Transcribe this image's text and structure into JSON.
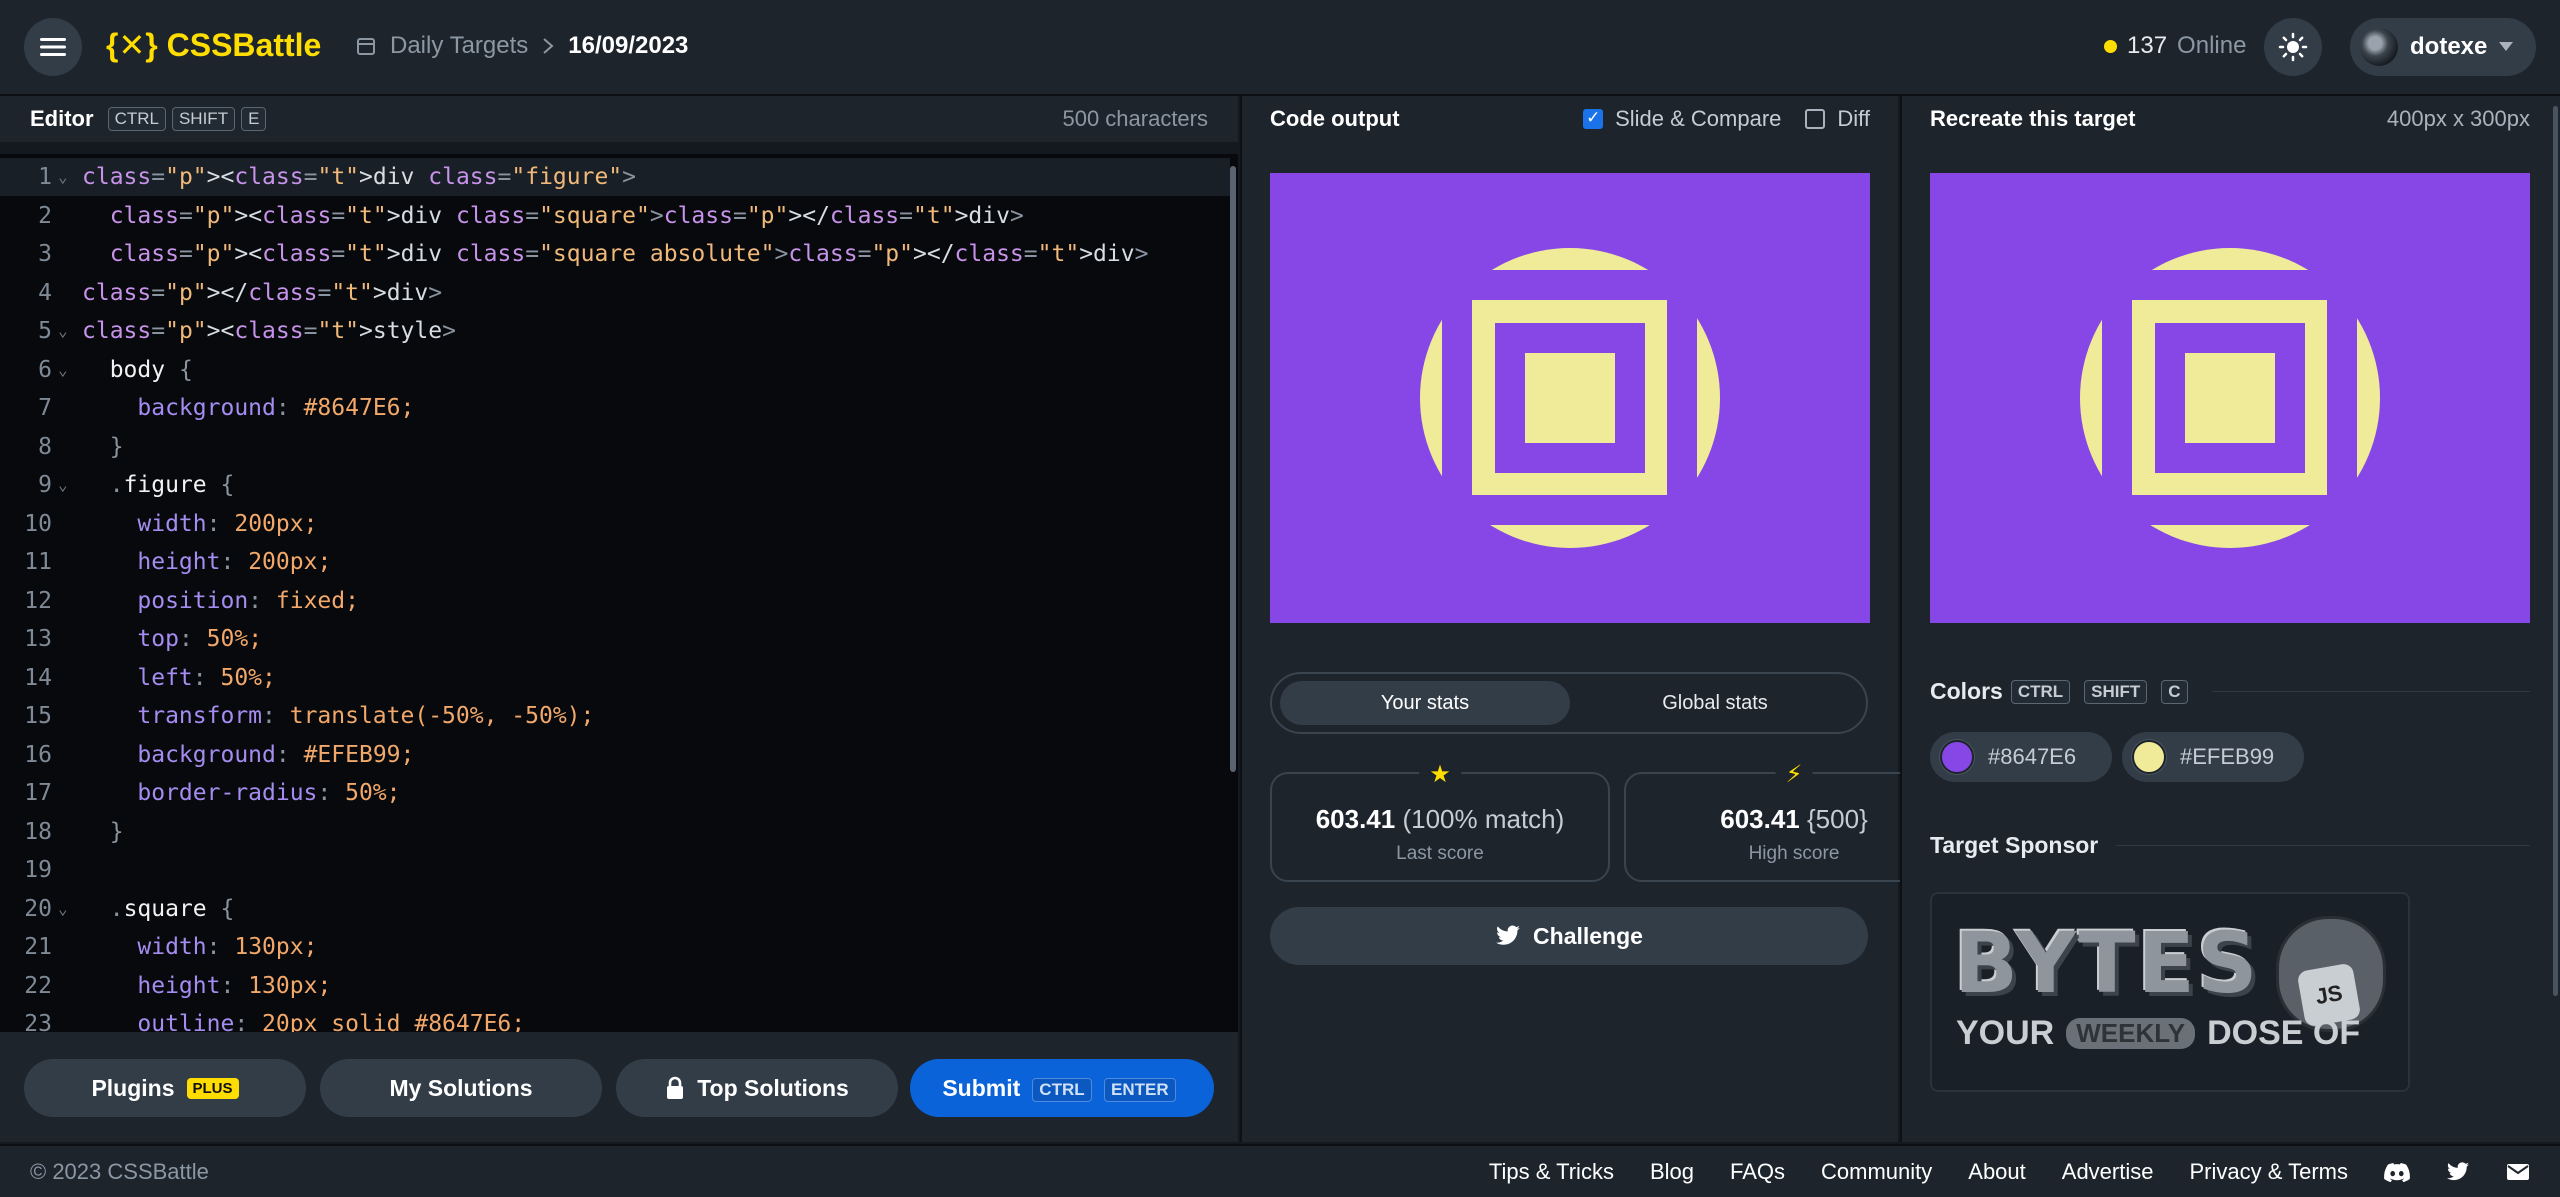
{
  "header": {
    "logo_text": "{✕} CSSBattle",
    "breadcrumb_section": "Daily Targets",
    "breadcrumb_date": "16/09/2023",
    "online_count": "137",
    "online_label": "Online",
    "username": "dotexe"
  },
  "editor": {
    "title": "Editor",
    "shortcut": [
      "CTRL",
      "SHIFT",
      "E"
    ],
    "char_count": "500 characters",
    "lines": [
      "<div class=\"figure\">",
      "  <div class=\"square\"></div>",
      "  <div class=\"square absolute\"></div>",
      "</div>",
      "<style>",
      "  body {",
      "    background: #8647E6;",
      "  }",
      "  .figure {",
      "    width: 200px;",
      "    height: 200px;",
      "    position: fixed;",
      "    top: 50%;",
      "    left: 50%;",
      "    transform: translate(-50%, -50%);",
      "    background: #EFEB99;",
      "    border-radius: 50%;",
      "  }",
      "",
      "  .square {",
      "    width: 130px;",
      "    height: 130px;",
      "    outline: 20px solid #8647E6;"
    ]
  },
  "buttons": {
    "plugins": "Plugins",
    "plus_badge": "PLUS",
    "my_solutions": "My Solutions",
    "top_solutions": "Top Solutions",
    "submit": "Submit",
    "submit_keys": [
      "CTRL",
      "ENTER"
    ]
  },
  "output": {
    "title": "Code output",
    "slide_compare": "Slide & Compare",
    "slide_compare_checked": true,
    "diff": "Diff",
    "diff_checked": false
  },
  "stats": {
    "tab_your": "Your stats",
    "tab_global": "Global stats",
    "last_score": "603.41",
    "last_match": "(100% match)",
    "last_label": "Last score",
    "high_score": "603.41",
    "high_chars": "{500}",
    "high_label": "High score",
    "challenge": "Challenge"
  },
  "target": {
    "title": "Recreate this target",
    "size": "400px x 300px",
    "colors_title": "Colors",
    "colors_keys": [
      "CTRL",
      "SHIFT",
      "C"
    ],
    "colors": [
      {
        "hex": "#8647E6",
        "value": "#8647e6"
      },
      {
        "hex": "#EFEB99",
        "value": "#efeb99"
      }
    ],
    "sponsor_title": "Target Sponsor",
    "sponsor_big": "BYTES",
    "sponsor_line_1": "YOUR",
    "sponsor_line_2": "WEEKLY",
    "sponsor_line_3": "DOSE OF",
    "sponsor_badge": "JS"
  },
  "footer": {
    "copyright": "© 2023 CSSBattle",
    "links": [
      "Tips & Tricks",
      "Blog",
      "FAQs",
      "Community",
      "About",
      "Advertise",
      "Privacy & Terms"
    ]
  }
}
